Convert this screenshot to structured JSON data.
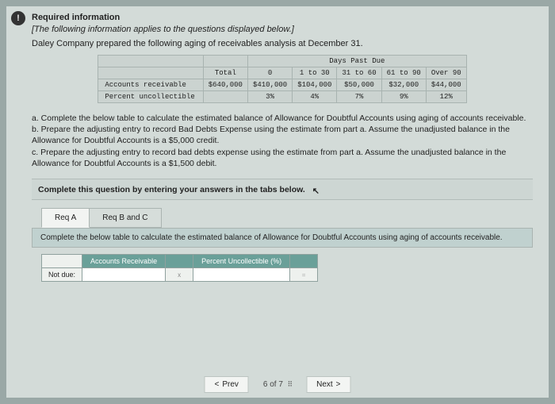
{
  "header": {
    "required_info": "Required information",
    "applies_note": "[The following information applies to the questions displayed below.]",
    "intro": "Daley Company prepared the following aging of receivables analysis at December 31."
  },
  "aging": {
    "group_header": "Days Past Due",
    "cols": [
      "Total",
      "0",
      "1 to 30",
      "31 to 60",
      "61 to 90",
      "Over 90"
    ],
    "rows": [
      {
        "label": "Accounts receivable",
        "vals": [
          "$640,000",
          "$410,000",
          "$104,000",
          "$50,000",
          "$32,000",
          "$44,000"
        ]
      },
      {
        "label": "Percent uncollectible",
        "vals": [
          "",
          "3%",
          "4%",
          "7%",
          "9%",
          "12%"
        ]
      }
    ]
  },
  "tasks": {
    "a": "a. Complete the below table to calculate the estimated balance of Allowance for Doubtful Accounts using aging of accounts receivable.",
    "b": "b. Prepare the adjusting entry to record Bad Debts Expense using the estimate from part a. Assume the unadjusted balance in the Allowance for Doubtful Accounts is a $5,000 credit.",
    "c": "c. Prepare the adjusting entry to record bad debts expense using the estimate from part a. Assume the unadjusted balance in the Allowance for Doubtful Accounts is a $1,500 debit."
  },
  "tabs": {
    "instruction": "Complete this question by entering your answers in the tabs below.",
    "tab_a": "Req A",
    "tab_bc": "Req B and C",
    "sub_instruction": "Complete the below table to calculate the estimated balance of Allowance for Doubtful Accounts using aging of accounts receivable."
  },
  "answer": {
    "col1": "Accounts Receivable",
    "col2": "Percent Uncollectible (%)",
    "row1_label": "Not due:",
    "x": "x",
    "eq": "="
  },
  "pager": {
    "prev": "Prev",
    "counter": "6 of 7",
    "next": "Next"
  },
  "chart_data": {
    "type": "table",
    "title": "Aging of Receivables Analysis at December 31",
    "columns": [
      "Total",
      "0",
      "1 to 30",
      "31 to 60",
      "61 to 90",
      "Over 90"
    ],
    "series": [
      {
        "name": "Accounts receivable",
        "values": [
          640000,
          410000,
          104000,
          50000,
          32000,
          44000
        ]
      },
      {
        "name": "Percent uncollectible",
        "values": [
          null,
          3,
          4,
          7,
          9,
          12
        ]
      }
    ]
  }
}
